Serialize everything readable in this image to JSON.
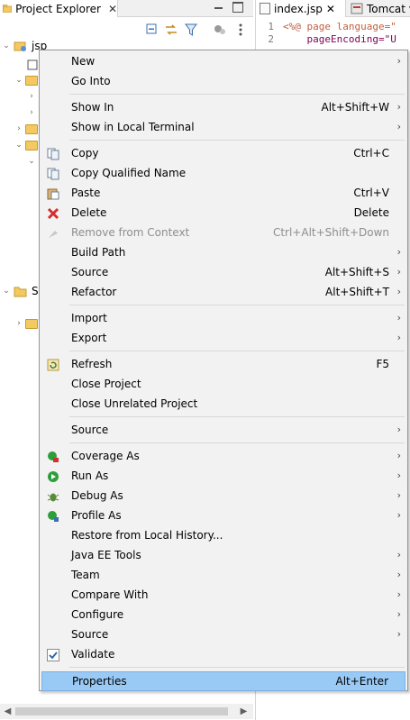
{
  "project_explorer": {
    "tab_title": "Project Explorer",
    "tree": [
      {
        "label": "jsp",
        "expanded": true
      },
      {
        "label": "S",
        "expanded": true
      }
    ]
  },
  "editor": {
    "tabs": [
      {
        "label": "index.jsp",
        "active": true
      },
      {
        "label": "Tomcat v",
        "active": false
      }
    ],
    "lines": [
      {
        "num": "1",
        "text": "<%@ page language=\""
      },
      {
        "num": "2",
        "text": "    pageEncoding=\"U"
      }
    ]
  },
  "context_menu": {
    "items": [
      {
        "label": "New",
        "shortcut": "",
        "submenu": true,
        "icon": ""
      },
      {
        "label": "Go Into",
        "shortcut": "",
        "submenu": false,
        "icon": ""
      },
      {
        "sep": true
      },
      {
        "label": "Show In",
        "shortcut": "Alt+Shift+W",
        "submenu": true,
        "icon": ""
      },
      {
        "label": "Show in Local Terminal",
        "shortcut": "",
        "submenu": true,
        "icon": ""
      },
      {
        "sep": true
      },
      {
        "label": "Copy",
        "shortcut": "Ctrl+C",
        "submenu": false,
        "icon": "copy-icon"
      },
      {
        "label": "Copy Qualified Name",
        "shortcut": "",
        "submenu": false,
        "icon": "copy-icon"
      },
      {
        "label": "Paste",
        "shortcut": "Ctrl+V",
        "submenu": false,
        "icon": "paste-icon"
      },
      {
        "label": "Delete",
        "shortcut": "Delete",
        "submenu": false,
        "icon": "delete-icon"
      },
      {
        "label": "Remove from Context",
        "shortcut": "Ctrl+Alt+Shift+Down",
        "submenu": false,
        "icon": "remove-context-icon",
        "disabled": true
      },
      {
        "label": "Build Path",
        "shortcut": "",
        "submenu": true,
        "icon": ""
      },
      {
        "label": "Source",
        "shortcut": "Alt+Shift+S",
        "submenu": true,
        "icon": ""
      },
      {
        "label": "Refactor",
        "shortcut": "Alt+Shift+T",
        "submenu": true,
        "icon": ""
      },
      {
        "sep": true
      },
      {
        "label": "Import",
        "shortcut": "",
        "submenu": true,
        "icon": ""
      },
      {
        "label": "Export",
        "shortcut": "",
        "submenu": true,
        "icon": ""
      },
      {
        "sep": true
      },
      {
        "label": "Refresh",
        "shortcut": "F5",
        "submenu": false,
        "icon": "refresh-icon"
      },
      {
        "label": "Close Project",
        "shortcut": "",
        "submenu": false,
        "icon": ""
      },
      {
        "label": "Close Unrelated Project",
        "shortcut": "",
        "submenu": false,
        "icon": ""
      },
      {
        "sep": true
      },
      {
        "label": "Source",
        "shortcut": "",
        "submenu": true,
        "icon": ""
      },
      {
        "sep": true
      },
      {
        "label": "Coverage As",
        "shortcut": "",
        "submenu": true,
        "icon": "coverage-icon"
      },
      {
        "label": "Run As",
        "shortcut": "",
        "submenu": true,
        "icon": "run-icon"
      },
      {
        "label": "Debug As",
        "shortcut": "",
        "submenu": true,
        "icon": "debug-icon"
      },
      {
        "label": "Profile As",
        "shortcut": "",
        "submenu": true,
        "icon": "profile-icon"
      },
      {
        "label": "Restore from Local History...",
        "shortcut": "",
        "submenu": false,
        "icon": ""
      },
      {
        "label": "Java EE Tools",
        "shortcut": "",
        "submenu": true,
        "icon": ""
      },
      {
        "label": "Team",
        "shortcut": "",
        "submenu": true,
        "icon": ""
      },
      {
        "label": "Compare With",
        "shortcut": "",
        "submenu": true,
        "icon": ""
      },
      {
        "label": "Configure",
        "shortcut": "",
        "submenu": true,
        "icon": ""
      },
      {
        "label": "Source",
        "shortcut": "",
        "submenu": true,
        "icon": ""
      },
      {
        "label": "Validate",
        "shortcut": "",
        "submenu": false,
        "icon": "validate-icon"
      },
      {
        "sep": true
      },
      {
        "label": "Properties",
        "shortcut": "Alt+Enter",
        "submenu": false,
        "icon": "",
        "highlighted": true
      }
    ]
  },
  "colors": {
    "menu_bg": "#f2f2f2",
    "highlight": "#99c9f5",
    "disabled_text": "#8e8e8e",
    "code_keyword": "#7f0055",
    "code_string": "#2a00ff",
    "code_directive": "#bf5f3f"
  }
}
